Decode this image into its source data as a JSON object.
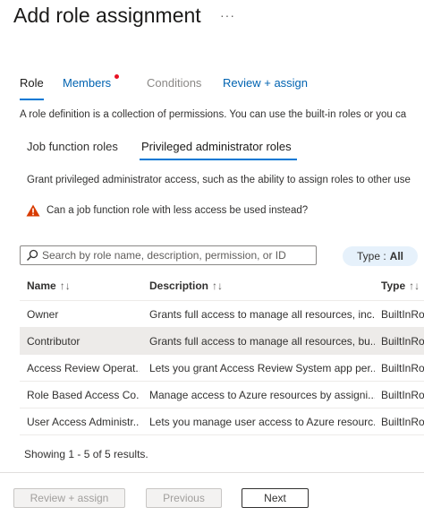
{
  "header": {
    "title": "Add role assignment",
    "more": "···"
  },
  "tabs": [
    {
      "label": "Role"
    },
    {
      "label": "Members"
    },
    {
      "label": "Conditions"
    },
    {
      "label": "Review + assign"
    }
  ],
  "description": "A role definition is a collection of permissions. You can use the built-in roles or you ca",
  "subtabs": [
    {
      "label": "Job function roles"
    },
    {
      "label": "Privileged administrator roles"
    }
  ],
  "grant_text": "Grant privileged administrator access, such as the ability to assign roles to other use",
  "warning": {
    "icon": "warning-icon",
    "text": "Can a job function role with less access be used instead?"
  },
  "search": {
    "placeholder": "Search by role name, description, permission, or ID",
    "value": ""
  },
  "filter": {
    "label": "Type :",
    "value": "All"
  },
  "table": {
    "headers": {
      "name": "Name",
      "description": "Description",
      "type": "Type"
    },
    "sort_glyph": "↑↓",
    "rows": [
      {
        "name": "Owner",
        "description": "Grants full access to manage all resources, inc...",
        "type": "BuiltInRo"
      },
      {
        "name": "Contributor",
        "description": "Grants full access to manage all resources, bu...",
        "type": "BuiltInRo"
      },
      {
        "name": "Access Review Operat...",
        "description": "Lets you grant Access Review System app per...",
        "type": "BuiltInRo"
      },
      {
        "name": "Role Based Access Co...",
        "description": "Manage access to Azure resources by assigni...",
        "type": "BuiltInRo"
      },
      {
        "name": "User Access Administr...",
        "description": "Lets you manage user access to Azure resourc...",
        "type": "BuiltInRo"
      }
    ]
  },
  "status": "Showing 1 - 5 of 5 results.",
  "footer": {
    "review_assign": "Review + assign",
    "previous": "Previous",
    "next": "Next"
  },
  "colors": {
    "accent": "#0078d4",
    "link": "#0063b1",
    "warning": "#d83b01",
    "notification_dot": "#e81123"
  }
}
